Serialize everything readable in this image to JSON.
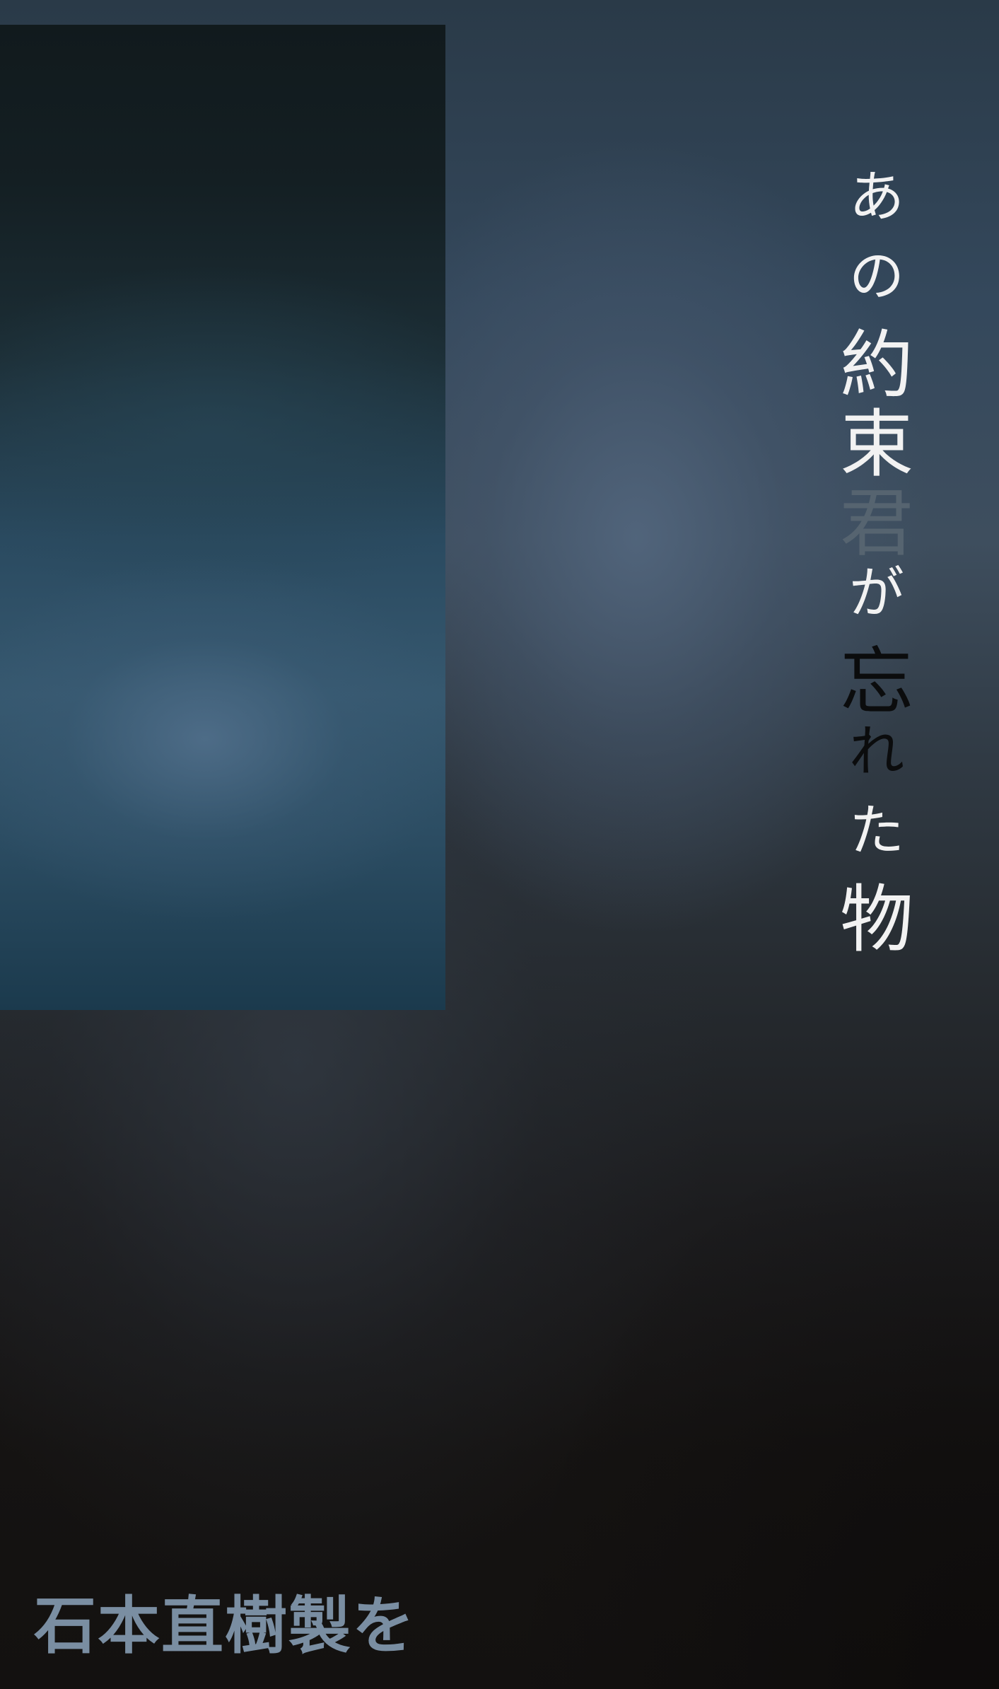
{
  "title": {
    "chars": [
      "あ",
      "の",
      "約",
      "束",
      "君",
      "が",
      "忘",
      "れ",
      "た",
      "物"
    ]
  },
  "author": "石本直樹製を",
  "colors": {
    "title_white": "#f2f2f2",
    "title_gray": "#566470",
    "title_black": "#0b0c0d",
    "author": "#7a8ea2"
  }
}
